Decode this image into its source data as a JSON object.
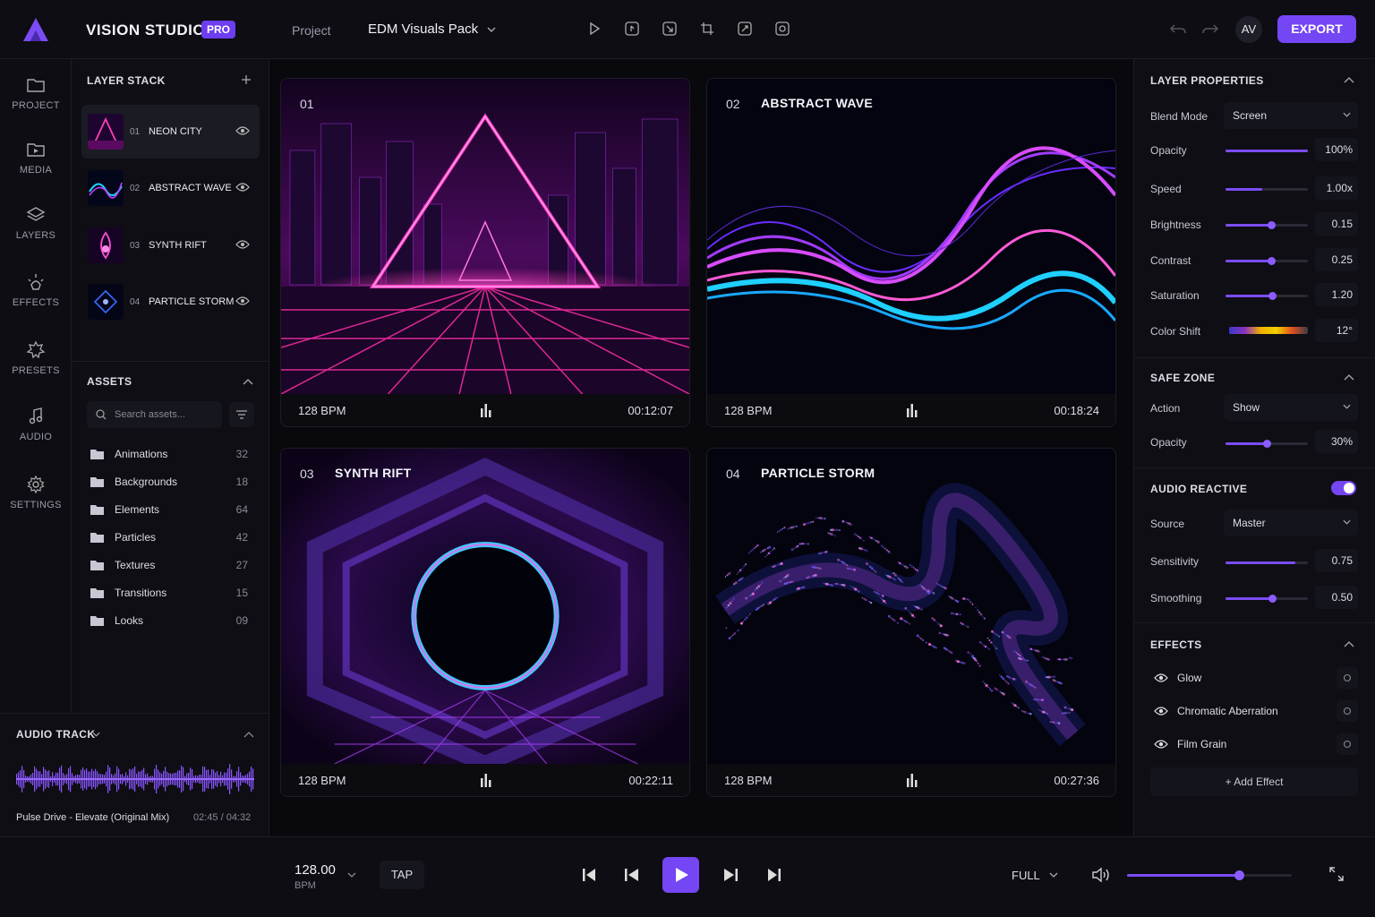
{
  "app": {
    "brand": "VISION STUDIO",
    "badge": "PRO",
    "project_label": "Project",
    "project_name": "EDM Visuals Pack",
    "avatar": "AV",
    "export_label": "EXPORT"
  },
  "colors": {
    "accent": "#7446f4",
    "background": "#0b0b10",
    "panel": "#0e0e14"
  },
  "toolbar": {
    "icons": [
      "play-icon",
      "frame-in-icon",
      "frame-out-icon",
      "crop-icon",
      "transform-icon",
      "mask-icon"
    ]
  },
  "rail": {
    "items": [
      {
        "label": "PROJECT",
        "icon": "folder-icon"
      },
      {
        "label": "MEDIA",
        "icon": "media-folder-icon"
      },
      {
        "label": "LAYERS",
        "icon": "layers-icon"
      },
      {
        "label": "EFFECTS",
        "icon": "effects-icon"
      },
      {
        "label": "PRESETS",
        "icon": "presets-icon"
      },
      {
        "label": "AUDIO",
        "icon": "music-note-icon"
      },
      {
        "label": "SETTINGS",
        "icon": "gear-icon"
      }
    ]
  },
  "layer_stack": {
    "title": "LAYER STACK",
    "layers": [
      {
        "num": "01",
        "name": "NEON CITY",
        "selected": true
      },
      {
        "num": "02",
        "name": "ABSTRACT WAVE"
      },
      {
        "num": "03",
        "name": "SYNTH RIFT"
      },
      {
        "num": "04",
        "name": "PARTICLE STORM"
      }
    ]
  },
  "assets": {
    "title": "ASSETS",
    "search_placeholder": "Search assets...",
    "folders": [
      {
        "name": "Animations",
        "count": "32"
      },
      {
        "name": "Backgrounds",
        "count": "18"
      },
      {
        "name": "Elements",
        "count": "64"
      },
      {
        "name": "Particles",
        "count": "42"
      },
      {
        "name": "Textures",
        "count": "27"
      },
      {
        "name": "Transitions",
        "count": "15"
      },
      {
        "name": "Looks",
        "count": "09"
      }
    ]
  },
  "audio_track": {
    "title": "AUDIO TRACK",
    "track": "Pulse Drive - Elevate (Original Mix)",
    "time": "02:45 / 04:32"
  },
  "tiles": [
    {
      "num": "01",
      "title": "",
      "bpm": "128 BPM",
      "duration": "00:12:07"
    },
    {
      "num": "02",
      "title": "ABSTRACT WAVE",
      "bpm": "128 BPM",
      "duration": "00:18:24"
    },
    {
      "num": "03",
      "title": "SYNTH RIFT",
      "bpm": "128 BPM",
      "duration": "00:22:11"
    },
    {
      "num": "04",
      "title": "PARTICLE STORM",
      "bpm": "128 BPM",
      "duration": "00:27:36"
    }
  ],
  "layer_properties": {
    "title": "LAYER PROPERTIES",
    "blend_mode": {
      "label": "Blend Mode",
      "value": "Screen"
    },
    "sliders": [
      {
        "label": "Opacity",
        "value": "100%",
        "level": 1.0
      },
      {
        "label": "Speed",
        "value": "1.00x",
        "level": 0.45
      },
      {
        "label": "Brightness",
        "value": "0.15",
        "level": 0.55
      },
      {
        "label": "Contrast",
        "value": "0.25",
        "level": 0.55
      },
      {
        "label": "Saturation",
        "value": "1.20",
        "level": 0.57
      }
    ],
    "color_shift": {
      "label": "Color Shift",
      "value": "12°"
    }
  },
  "safe_zone": {
    "title": "SAFE ZONE",
    "action": {
      "label": "Action",
      "value": "Show"
    },
    "opacity": {
      "label": "Opacity",
      "value": "30%",
      "level": 0.5
    }
  },
  "audio_reactive": {
    "title": "AUDIO REACTIVE",
    "enabled": true,
    "source": {
      "label": "Source",
      "value": "Master"
    },
    "sensitivity": {
      "label": "Sensitivity",
      "value": "0.75",
      "level": 0.85
    },
    "smoothing": {
      "label": "Smoothing",
      "value": "0.50",
      "level": 0.57
    }
  },
  "effects": {
    "title": "EFFECTS",
    "items": [
      "Glow",
      "Chromatic Aberration",
      "Film Grain"
    ],
    "add_label": "+ Add Effect"
  },
  "transport": {
    "bpm": "128.00",
    "bpm_label": "BPM",
    "tap": "TAP",
    "view": "FULL",
    "volume": 0.68
  }
}
